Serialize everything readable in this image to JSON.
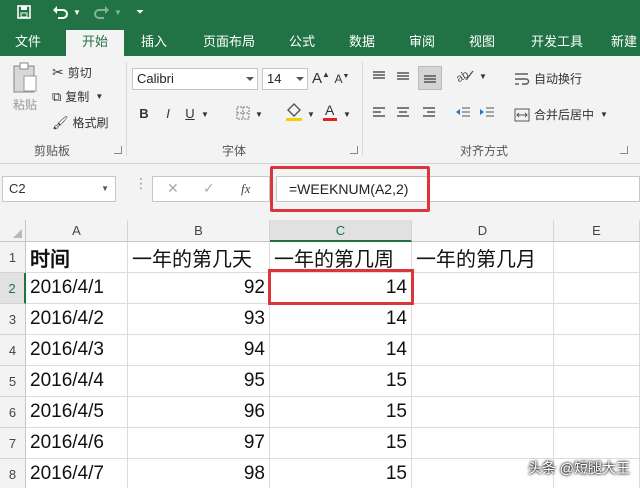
{
  "tabs": [
    {
      "label": "文件",
      "active": false
    },
    {
      "label": "开始",
      "active": true
    },
    {
      "label": "插入",
      "active": false
    },
    {
      "label": "页面布局",
      "active": false
    },
    {
      "label": "公式",
      "active": false
    },
    {
      "label": "数据",
      "active": false
    },
    {
      "label": "审阅",
      "active": false
    },
    {
      "label": "视图",
      "active": false
    },
    {
      "label": "开发工具",
      "active": false
    },
    {
      "label": "新建",
      "active": false
    }
  ],
  "clipboard": {
    "paste_label": "粘贴",
    "cut_label": "剪切",
    "copy_label": "复制",
    "format_painter_label": "格式刷",
    "group_label": "剪贴板"
  },
  "font": {
    "name": "Calibri",
    "size": "14",
    "bold": "B",
    "italic": "I",
    "underline": "U",
    "group_label": "字体",
    "grow": "A",
    "shrink": "A"
  },
  "alignment": {
    "wrap_label": "自动换行",
    "merge_label": "合并后居中",
    "group_label": "对齐方式"
  },
  "formula_bar": {
    "name_box": "C2",
    "fx": "fx",
    "formula": "=WEEKNUM(A2,2)"
  },
  "columns": [
    "A",
    "B",
    "C",
    "D",
    "E"
  ],
  "selected_column": "C",
  "rows": [
    {
      "n": "1",
      "a": "时间",
      "b": "一年的第几天",
      "c": "一年的第几周",
      "d": "一年的第几月"
    },
    {
      "n": "2",
      "a": "2016/4/1",
      "b": "92",
      "c": "14",
      "d": ""
    },
    {
      "n": "3",
      "a": "2016/4/2",
      "b": "93",
      "c": "14",
      "d": ""
    },
    {
      "n": "4",
      "a": "2016/4/3",
      "b": "94",
      "c": "14",
      "d": ""
    },
    {
      "n": "5",
      "a": "2016/4/4",
      "b": "95",
      "c": "15",
      "d": ""
    },
    {
      "n": "6",
      "a": "2016/4/5",
      "b": "96",
      "c": "15",
      "d": ""
    },
    {
      "n": "7",
      "a": "2016/4/6",
      "b": "97",
      "c": "15",
      "d": ""
    },
    {
      "n": "8",
      "a": "2016/4/7",
      "b": "98",
      "c": "15",
      "d": ""
    }
  ],
  "selected_row": "2",
  "watermark": "头条 @短腿大王",
  "colors": {
    "accent": "#217346",
    "highlight": "#d9363e"
  }
}
